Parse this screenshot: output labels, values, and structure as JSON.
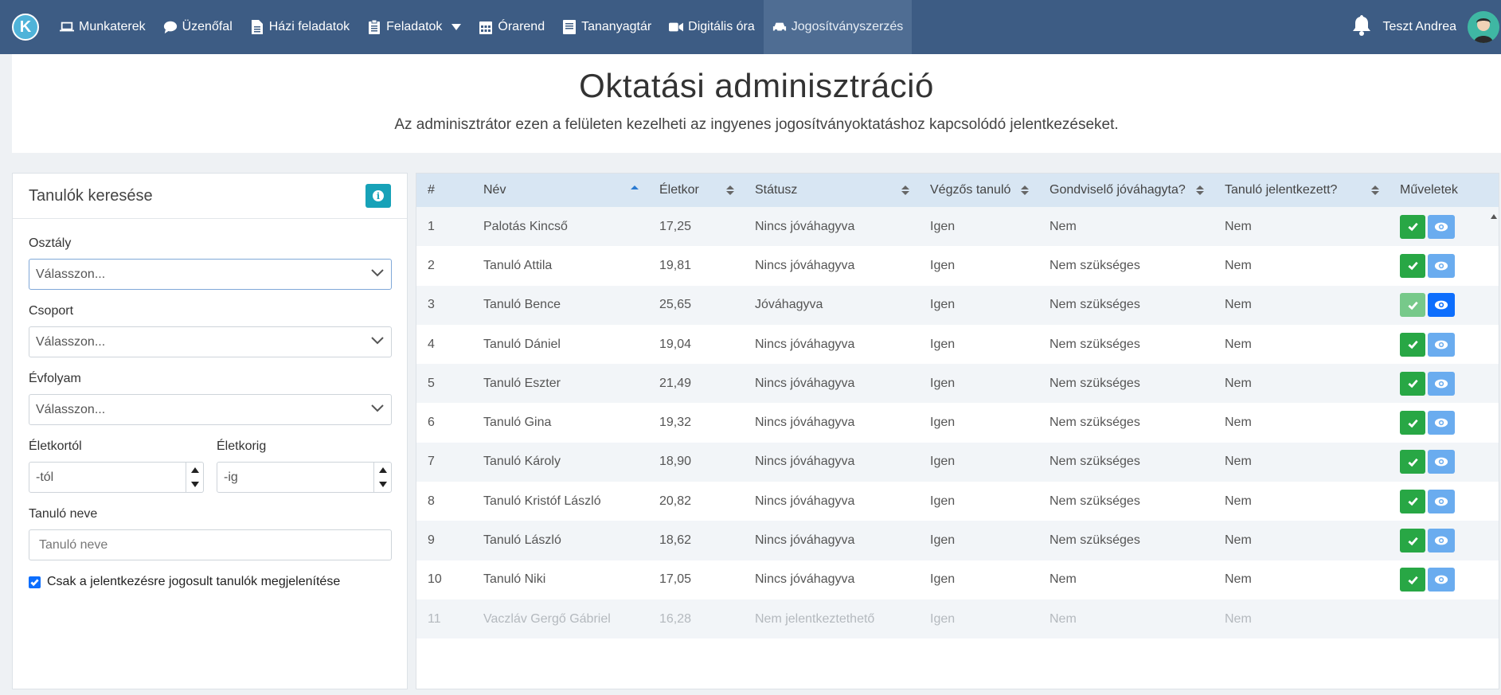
{
  "navbar": {
    "logo_letter": "K",
    "items": [
      {
        "label": "Munkaterek",
        "icon": "laptop-icon"
      },
      {
        "label": "Üzenőfal",
        "icon": "comment-icon"
      },
      {
        "label": "Házi feladatok",
        "icon": "file-icon"
      },
      {
        "label": "Feladatok",
        "icon": "clipboard-icon"
      },
      {
        "label": "Órarend",
        "icon": "calendar-icon"
      },
      {
        "label": "Tananyagtár",
        "icon": "book-icon"
      },
      {
        "label": "Digitális óra",
        "icon": "video-icon"
      },
      {
        "label": "Jogosítványszerzés",
        "icon": "car-icon"
      }
    ],
    "user_name": "Teszt Andrea"
  },
  "header": {
    "title": "Oktatási adminisztráció",
    "subtitle": "Az adminisztrátor ezen a felületen kezelheti az ingyenes jogosítványoktatáshoz kapcsolódó jelentkezéseket."
  },
  "search": {
    "title": "Tanulók keresése",
    "class_label": "Osztály",
    "class_value": "Válasszon...",
    "group_label": "Csoport",
    "group_value": "Válasszon...",
    "grade_label": "Évfolyam",
    "grade_value": "Válasszon...",
    "age_from_label": "Életkortól",
    "age_from_placeholder": "-tól",
    "age_to_label": "Életkorig",
    "age_to_placeholder": "-ig",
    "name_label": "Tanuló neve",
    "name_placeholder": "Tanuló neve",
    "checkbox_label": "Csak a jelentkezésre jogosult tanulók megjelenítése"
  },
  "table": {
    "headers": [
      "#",
      "Név",
      "Életkor",
      "Státusz",
      "Végzős tanuló",
      "Gondviselő jóváhagyta?",
      "Tanuló jelentkezett?",
      "Műveletek"
    ],
    "rows": [
      {
        "num": "1",
        "name": "Palotás Kincső",
        "age": "17,25",
        "status": "Nincs jóváhagyva",
        "senior": "Igen",
        "guardian": "Nem",
        "applied": "Nem"
      },
      {
        "num": "2",
        "name": "Tanuló Attila",
        "age": "19,81",
        "status": "Nincs jóváhagyva",
        "senior": "Igen",
        "guardian": "Nem szükséges",
        "applied": "Nem"
      },
      {
        "num": "3",
        "name": "Tanuló Bence",
        "age": "25,65",
        "status": "Jóváhagyva",
        "senior": "Igen",
        "guardian": "Nem szükséges",
        "applied": "Nem"
      },
      {
        "num": "4",
        "name": "Tanuló Dániel",
        "age": "19,04",
        "status": "Nincs jóváhagyva",
        "senior": "Igen",
        "guardian": "Nem szükséges",
        "applied": "Nem"
      },
      {
        "num": "5",
        "name": "Tanuló Eszter",
        "age": "21,49",
        "status": "Nincs jóváhagyva",
        "senior": "Igen",
        "guardian": "Nem szükséges",
        "applied": "Nem"
      },
      {
        "num": "6",
        "name": "Tanuló Gina",
        "age": "19,32",
        "status": "Nincs jóváhagyva",
        "senior": "Igen",
        "guardian": "Nem szükséges",
        "applied": "Nem"
      },
      {
        "num": "7",
        "name": "Tanuló Károly",
        "age": "18,90",
        "status": "Nincs jóváhagyva",
        "senior": "Igen",
        "guardian": "Nem szükséges",
        "applied": "Nem"
      },
      {
        "num": "8",
        "name": "Tanuló Kristóf László",
        "age": "20,82",
        "status": "Nincs jóváhagyva",
        "senior": "Igen",
        "guardian": "Nem szükséges",
        "applied": "Nem"
      },
      {
        "num": "9",
        "name": "Tanuló László",
        "age": "18,62",
        "status": "Nincs jóváhagyva",
        "senior": "Igen",
        "guardian": "Nem szükséges",
        "applied": "Nem"
      },
      {
        "num": "10",
        "name": "Tanuló Niki",
        "age": "17,05",
        "status": "Nincs jóváhagyva",
        "senior": "Igen",
        "guardian": "Nem",
        "applied": "Nem"
      },
      {
        "num": "11",
        "name": "Vaczláv Gergő Gábriel",
        "age": "16,28",
        "status": "Nem jelentkeztethető",
        "senior": "Igen",
        "guardian": "Nem",
        "applied": "Nem"
      }
    ]
  },
  "colors": {
    "navbar": "#3d5c84",
    "approve": "#28a745",
    "view": "#6aacef",
    "info": "#17a2b8",
    "table_header": "#d8e6f3"
  }
}
